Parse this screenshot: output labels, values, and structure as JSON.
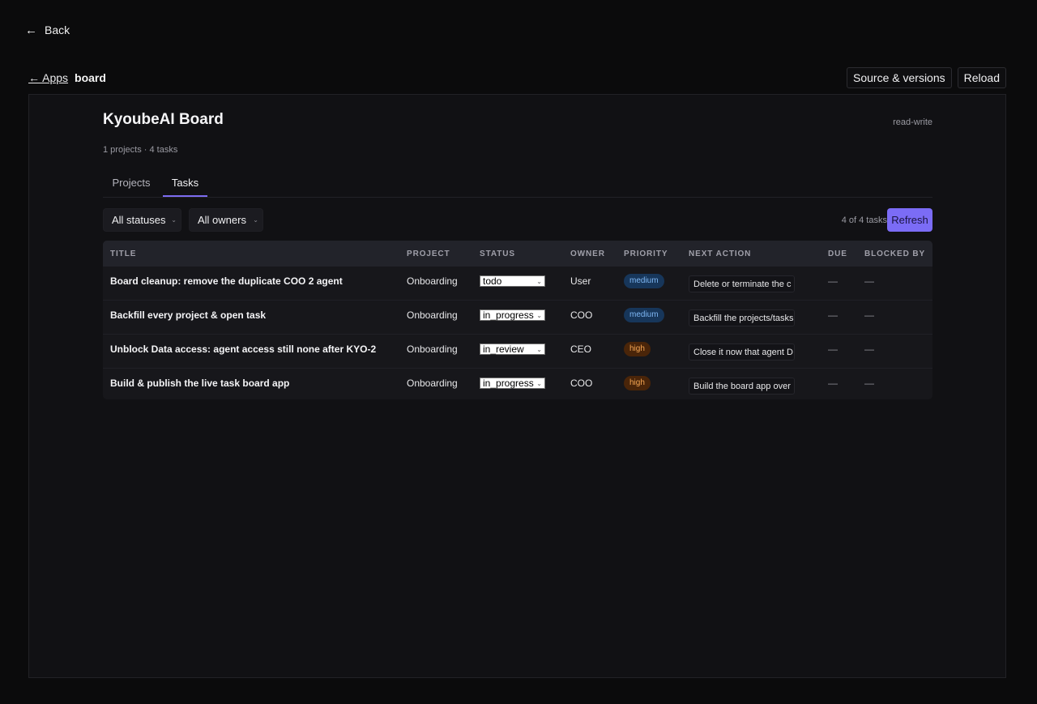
{
  "nav": {
    "back_label": "Back"
  },
  "appbar": {
    "apps_link": "← Apps",
    "app_name": "board",
    "source_button": "Source & versions",
    "reload_button": "Reload"
  },
  "board": {
    "title": "KyoubeAI Board",
    "access": "read-write",
    "summary": "1 projects · 4 tasks",
    "tabs": [
      {
        "label": "Projects",
        "active": false
      },
      {
        "label": "Tasks",
        "active": true
      }
    ],
    "filters": {
      "status": "All statuses",
      "owner": "All owners"
    },
    "task_count": "4 of 4 tasks",
    "refresh_label": "Refresh",
    "columns": [
      "TITLE",
      "PROJECT",
      "STATUS",
      "OWNER",
      "PRIORITY",
      "NEXT ACTION",
      "DUE",
      "BLOCKED BY"
    ],
    "rows": [
      {
        "title": "Board cleanup: remove the duplicate COO 2 agent",
        "project": "Onboarding",
        "status": "todo",
        "owner": "User",
        "priority": "medium",
        "next_action": "Delete or terminate the c",
        "due": "—",
        "blocked_by": "—"
      },
      {
        "title": "Backfill every project & open task",
        "project": "Onboarding",
        "status": "in_progress",
        "owner": "COO",
        "priority": "medium",
        "next_action": "Backfill the projects/tasks",
        "due": "—",
        "blocked_by": "—"
      },
      {
        "title": "Unblock Data access: agent access still none after KYO-2",
        "project": "Onboarding",
        "status": "in_review",
        "owner": "CEO",
        "priority": "high",
        "next_action": "Close it now that agent D",
        "due": "—",
        "blocked_by": "—"
      },
      {
        "title": "Build & publish the live task board app",
        "project": "Onboarding",
        "status": "in_progress",
        "owner": "COO",
        "priority": "high",
        "next_action": "Build the board app over",
        "due": "—",
        "blocked_by": "—"
      }
    ]
  },
  "colors": {
    "accent": "#7b6cf6",
    "background": "#0b0b0c",
    "panel": "#111114",
    "badge_medium": "#17365a",
    "badge_high": "#4a2509"
  }
}
